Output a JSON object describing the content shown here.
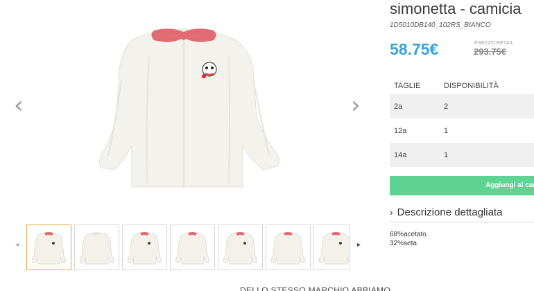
{
  "gallery": {
    "prev_arrow": "‹",
    "next_arrow": "›",
    "thumb_prev": "◂",
    "thumb_next": "▸",
    "thumbnail_count": 7,
    "active_border_color": "#e8a24a"
  },
  "product": {
    "title": "simonetta - camicia",
    "sku": "1D5010DB140_102RS_BIANCO",
    "price": "58.75€",
    "retail_label": "PREZZO RETAIL",
    "retail_price": "293.75€",
    "price_color": "#3aa1dc"
  },
  "sizes": {
    "header_size": "TAGLIE",
    "header_availability": "DISPONIBILITÀ",
    "rows": [
      {
        "size": "2a",
        "qty": "2"
      },
      {
        "size": "12a",
        "qty": "1"
      },
      {
        "size": "14a",
        "qty": "1"
      }
    ]
  },
  "cart": {
    "add_label": "Aggiungi al carrello",
    "button_color": "#5fd492"
  },
  "description": {
    "heading": "Descrizione dettagliata",
    "chevron": "›",
    "composition": [
      "68%acetato",
      "32%seta"
    ]
  },
  "footer": {
    "same_brand": "DELLO STESSO MARCHIO ABBIAMO"
  }
}
